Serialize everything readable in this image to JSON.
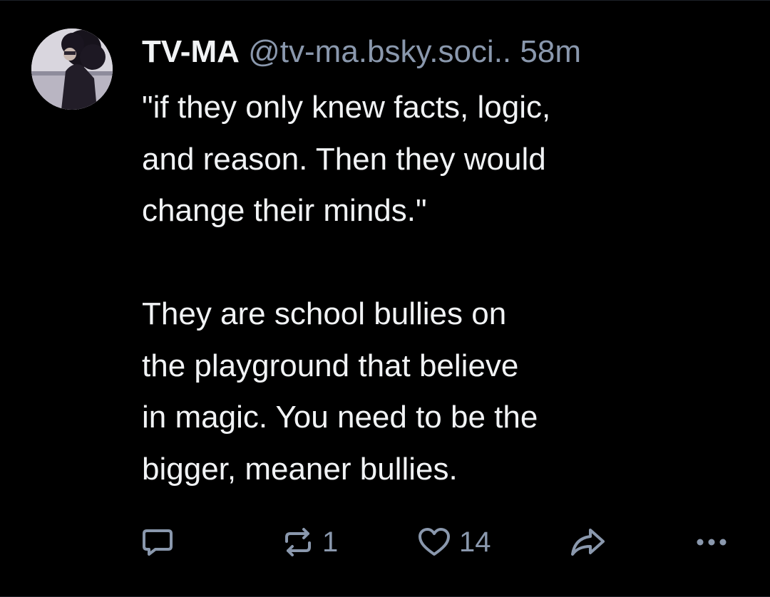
{
  "post": {
    "author": {
      "display_name": "TV-MA",
      "handle": "@tv-ma.bsky.soci..",
      "avatar_icon": "profile-photo"
    },
    "timestamp": "58m",
    "text": "\"if they only knew facts, logic,\nand reason. Then they would\nchange their minds.\"\n\nThey are school bullies on\nthe playground that believe\nin magic. You need to be the\nbigger, meaner bullies.",
    "actions": {
      "reply": {
        "icon": "reply-icon"
      },
      "repost": {
        "icon": "repost-icon",
        "count": "1"
      },
      "like": {
        "icon": "heart-icon",
        "count": "14"
      },
      "share": {
        "icon": "share-icon"
      },
      "more": {
        "icon": "more-icon"
      }
    }
  },
  "colors": {
    "background": "#000000",
    "text": "#f1f3f5",
    "muted": "#8a98ad"
  }
}
